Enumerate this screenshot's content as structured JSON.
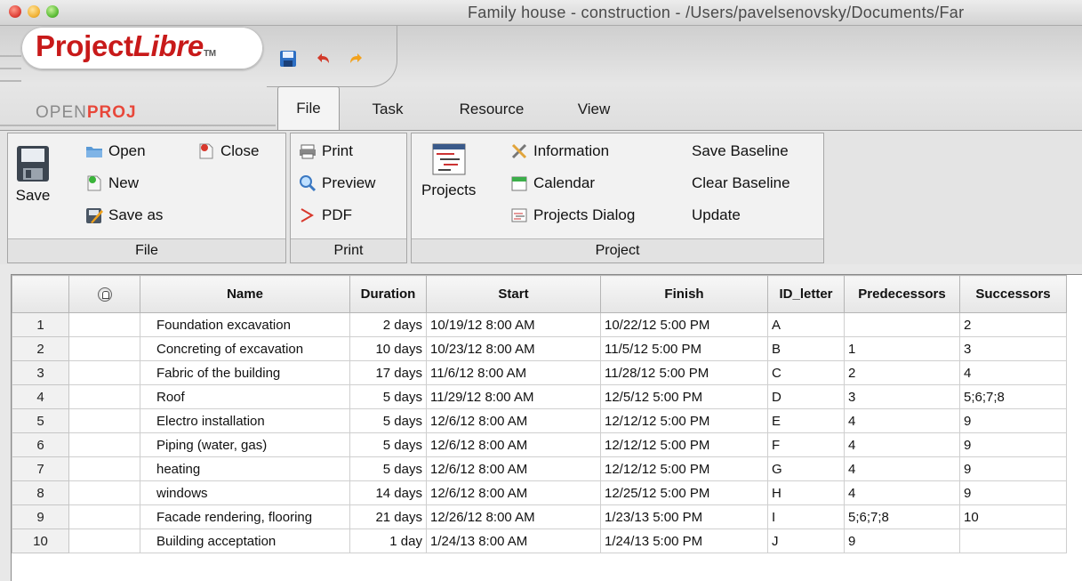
{
  "window": {
    "title": "Family house - construction - /Users/pavelsenovsky/Documents/Far"
  },
  "logo": {
    "project": "Project",
    "libre": "Libre",
    "tm": "TM",
    "openproj_part1": "OPEN",
    "openproj_part2": "PROJ"
  },
  "quick_access": {
    "save_icon": "floppy-disk-icon",
    "undo_icon": "undo-arrow-icon",
    "redo_icon": "redo-arrow-icon"
  },
  "tabs": [
    {
      "label": "File",
      "active": true
    },
    {
      "label": "Task"
    },
    {
      "label": "Resource"
    },
    {
      "label": "View"
    }
  ],
  "ribbon": {
    "file_group": {
      "label": "File",
      "save": "Save",
      "open": "Open",
      "close": "Close",
      "new": "New",
      "save_as": "Save as"
    },
    "print_group": {
      "label": "Print",
      "print": "Print",
      "preview": "Preview",
      "pdf": "PDF"
    },
    "project_group": {
      "label": "Project",
      "projects": "Projects",
      "information": "Information",
      "calendar": "Calendar",
      "projects_dialog": "Projects Dialog",
      "save_baseline": "Save Baseline",
      "clear_baseline": "Clear Baseline",
      "update": "Update"
    }
  },
  "table": {
    "columns": [
      "",
      "",
      "Name",
      "Duration",
      "Start",
      "Finish",
      "ID_letter",
      "Predecessors",
      "Successors"
    ],
    "rows": [
      {
        "n": "1",
        "name": "Foundation excavation",
        "duration": "2 days",
        "start": "10/19/12 8:00 AM",
        "finish": "10/22/12 5:00 PM",
        "id": "A",
        "pred": "",
        "succ": "2"
      },
      {
        "n": "2",
        "name": "Concreting of excavation",
        "duration": "10 days",
        "start": "10/23/12 8:00 AM",
        "finish": "11/5/12 5:00 PM",
        "id": "B",
        "pred": "1",
        "succ": "3"
      },
      {
        "n": "3",
        "name": "Fabric of the building",
        "duration": "17 days",
        "start": "11/6/12 8:00 AM",
        "finish": "11/28/12 5:00 PM",
        "id": "C",
        "pred": "2",
        "succ": "4"
      },
      {
        "n": "4",
        "name": "Roof",
        "duration": "5 days",
        "start": "11/29/12 8:00 AM",
        "finish": "12/5/12 5:00 PM",
        "id": "D",
        "pred": "3",
        "succ": "5;6;7;8"
      },
      {
        "n": "5",
        "name": "Electro installation",
        "duration": "5 days",
        "start": "12/6/12 8:00 AM",
        "finish": "12/12/12 5:00 PM",
        "id": "E",
        "pred": "4",
        "succ": "9"
      },
      {
        "n": "6",
        "name": "Piping (water, gas)",
        "duration": "5 days",
        "start": "12/6/12 8:00 AM",
        "finish": "12/12/12 5:00 PM",
        "id": "F",
        "pred": "4",
        "succ": "9"
      },
      {
        "n": "7",
        "name": "heating",
        "duration": "5 days",
        "start": "12/6/12 8:00 AM",
        "finish": "12/12/12 5:00 PM",
        "id": "G",
        "pred": "4",
        "succ": "9"
      },
      {
        "n": "8",
        "name": "windows",
        "duration": "14 days",
        "start": "12/6/12 8:00 AM",
        "finish": "12/25/12 5:00 PM",
        "id": "H",
        "pred": "4",
        "succ": "9"
      },
      {
        "n": "9",
        "name": "Facade rendering, flooring",
        "duration": "21 days",
        "start": "12/26/12 8:00 AM",
        "finish": "1/23/13 5:00 PM",
        "id": "I",
        "pred": "5;6;7;8",
        "succ": "10"
      },
      {
        "n": "10",
        "name": "Building acceptation",
        "duration": "1 day",
        "start": "1/24/13 8:00 AM",
        "finish": "1/24/13 5:00 PM",
        "id": "J",
        "pred": "9",
        "succ": ""
      }
    ]
  }
}
